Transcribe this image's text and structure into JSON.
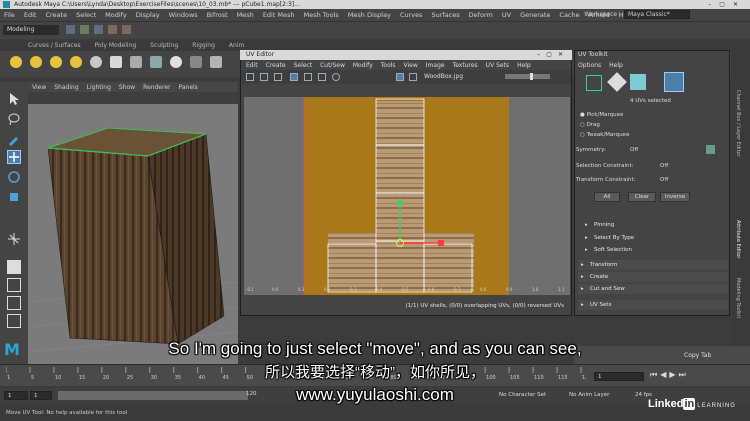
{
  "window": {
    "title": "Autodesk Maya  C:\\Users\\Lynda\\Desktop\\ExerciseFiles\\scenes\\10_03.mb*  ---  pCube1.map[2:3]..."
  },
  "menubar": {
    "items": [
      "File",
      "Edit",
      "Create",
      "Select",
      "Modify",
      "Display",
      "Windows",
      "Bifrost",
      "Mesh",
      "Edit Mesh",
      "Mesh Tools",
      "Mesh Display",
      "Curves",
      "Surfaces",
      "Deform",
      "UV",
      "Generate",
      "Cache",
      "Arnold",
      "Help"
    ],
    "workspace_label": "Workspace :",
    "workspace_value": "Maya Classic*"
  },
  "statusline": {
    "mode": "Modeling"
  },
  "shelf": {
    "tabs": [
      "Curves / Surfaces",
      "Poly Modeling",
      "Sculpting",
      "Rigging",
      "Anim"
    ]
  },
  "viewport": {
    "menu": [
      "View",
      "Shading",
      "Lighting",
      "Show",
      "Renderer",
      "Panels"
    ]
  },
  "uv_editor": {
    "title": "UV Editor",
    "menu": [
      "Edit",
      "Create",
      "Select",
      "Cut/Sew",
      "Modify",
      "Tools",
      "View",
      "Image",
      "Textures",
      "UV Sets",
      "Help"
    ],
    "texture": "WoodBox.jpg",
    "status": "(1/1) UV shells, (0/0) overlapping UVs, (0/0) reversed UVs",
    "axis_labels": [
      "-0.1",
      "0.0",
      "0.1",
      "0.2",
      "0.3",
      "0.4",
      "0.5",
      "0.6",
      "0.7",
      "0.8",
      "0.9",
      "1.0",
      "1.1"
    ]
  },
  "uv_toolkit": {
    "title": "UV Toolkit",
    "menu": [
      "Options",
      "Help"
    ],
    "selected_count": "4 UVs selected",
    "modes": [
      "Pick/Marquee",
      "Drag",
      "Tweak/Marquee"
    ],
    "symmetry_label": "Symmetry:",
    "symmetry_value": "Off",
    "sel_constraint_label": "Selection Constraint:",
    "sel_constraint_value": "Off",
    "transform_constraint_label": "Transform Constraint:",
    "transform_constraint_value": "Off",
    "buttons": [
      "All",
      "Clear",
      "Inverse"
    ],
    "pinning": "Pinning",
    "select_by_type": "Select By Type",
    "soft_selection": "Soft Selection",
    "sections": [
      "Transform",
      "Create",
      "Cut and Sew",
      "UV Sets"
    ]
  },
  "side_tabs": [
    "Channel Box / Layer Editor",
    "Attribute Editor",
    "Modeling Toolkit"
  ],
  "copy_tab": "Copy Tab",
  "timeline": {
    "ticks": [
      "1",
      "5",
      "10",
      "15",
      "20",
      "25",
      "30",
      "35",
      "40",
      "45",
      "50",
      "55",
      "60",
      "65",
      "70",
      "75",
      "80",
      "85",
      "90",
      "95",
      "100",
      "105",
      "110",
      "115",
      "120"
    ],
    "current_frame": "1",
    "range_start": "1",
    "range_start2": "1",
    "range_end": "120",
    "no_character_set": "No Character Set",
    "no_anim_layer": "No Anim Layer",
    "fps": "24 fps"
  },
  "helpline": "Move UV Tool: No help available for this tool",
  "subtitles": {
    "line1": "So I'm going to just select \"move\", and as you can see,",
    "line2": "所以我要选择“移动”，如你所见，",
    "line3": "www.yuyulaoshi.com"
  },
  "watermark": {
    "brand_left": "Linked",
    "brand_in": "in",
    "brand_learning": "LEARNING"
  }
}
